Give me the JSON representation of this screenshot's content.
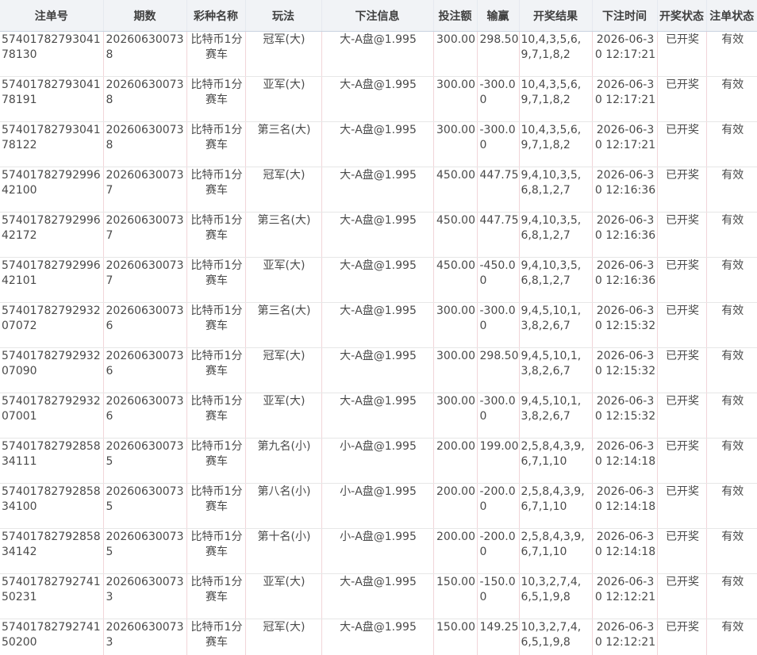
{
  "headers": [
    "注单号",
    "期数",
    "彩种名称",
    "玩法",
    "下注信息",
    "投注额",
    "输赢",
    "开奖结果",
    "下注时间",
    "开奖状态",
    "注单状态"
  ],
  "rows": [
    {
      "order_no": "5740178279304178130",
      "issue": "202606300738",
      "lottery": "比特币1分赛车",
      "play": "冠军(大)",
      "info": "大-A盘@1.995",
      "amount": "300.00",
      "win_loss": "298.50",
      "result": "10,4,3,5,6,9,7,1,8,2",
      "time": "2026-06-30 12:17:21",
      "draw_status": "已开奖",
      "order_status": "有效"
    },
    {
      "order_no": "5740178279304178191",
      "issue": "202606300738",
      "lottery": "比特币1分赛车",
      "play": "亚军(大)",
      "info": "大-A盘@1.995",
      "amount": "300.00",
      "win_loss": "-300.00",
      "result": "10,4,3,5,6,9,7,1,8,2",
      "time": "2026-06-30 12:17:21",
      "draw_status": "已开奖",
      "order_status": "有效"
    },
    {
      "order_no": "5740178279304178122",
      "issue": "202606300738",
      "lottery": "比特币1分赛车",
      "play": "第三名(大)",
      "info": "大-A盘@1.995",
      "amount": "300.00",
      "win_loss": "-300.00",
      "result": "10,4,3,5,6,9,7,1,8,2",
      "time": "2026-06-30 12:17:21",
      "draw_status": "已开奖",
      "order_status": "有效"
    },
    {
      "order_no": "5740178279299642100",
      "issue": "202606300737",
      "lottery": "比特币1分赛车",
      "play": "冠军(大)",
      "info": "大-A盘@1.995",
      "amount": "450.00",
      "win_loss": "447.75",
      "result": "9,4,10,3,5,6,8,1,2,7",
      "time": "2026-06-30 12:16:36",
      "draw_status": "已开奖",
      "order_status": "有效"
    },
    {
      "order_no": "5740178279299642172",
      "issue": "202606300737",
      "lottery": "比特币1分赛车",
      "play": "第三名(大)",
      "info": "大-A盘@1.995",
      "amount": "450.00",
      "win_loss": "447.75",
      "result": "9,4,10,3,5,6,8,1,2,7",
      "time": "2026-06-30 12:16:36",
      "draw_status": "已开奖",
      "order_status": "有效"
    },
    {
      "order_no": "5740178279299642101",
      "issue": "202606300737",
      "lottery": "比特币1分赛车",
      "play": "亚军(大)",
      "info": "大-A盘@1.995",
      "amount": "450.00",
      "win_loss": "-450.00",
      "result": "9,4,10,3,5,6,8,1,2,7",
      "time": "2026-06-30 12:16:36",
      "draw_status": "已开奖",
      "order_status": "有效"
    },
    {
      "order_no": "5740178279293207072",
      "issue": "202606300736",
      "lottery": "比特币1分赛车",
      "play": "第三名(大)",
      "info": "大-A盘@1.995",
      "amount": "300.00",
      "win_loss": "-300.00",
      "result": "9,4,5,10,1,3,8,2,6,7",
      "time": "2026-06-30 12:15:32",
      "draw_status": "已开奖",
      "order_status": "有效"
    },
    {
      "order_no": "5740178279293207090",
      "issue": "202606300736",
      "lottery": "比特币1分赛车",
      "play": "冠军(大)",
      "info": "大-A盘@1.995",
      "amount": "300.00",
      "win_loss": "298.50",
      "result": "9,4,5,10,1,3,8,2,6,7",
      "time": "2026-06-30 12:15:32",
      "draw_status": "已开奖",
      "order_status": "有效"
    },
    {
      "order_no": "5740178279293207001",
      "issue": "202606300736",
      "lottery": "比特币1分赛车",
      "play": "亚军(大)",
      "info": "大-A盘@1.995",
      "amount": "300.00",
      "win_loss": "-300.00",
      "result": "9,4,5,10,1,3,8,2,6,7",
      "time": "2026-06-30 12:15:32",
      "draw_status": "已开奖",
      "order_status": "有效"
    },
    {
      "order_no": "5740178279285834111",
      "issue": "202606300735",
      "lottery": "比特币1分赛车",
      "play": "第九名(小)",
      "info": "小-A盘@1.995",
      "amount": "200.00",
      "win_loss": "199.00",
      "result": "2,5,8,4,3,9,6,7,1,10",
      "time": "2026-06-30 12:14:18",
      "draw_status": "已开奖",
      "order_status": "有效"
    },
    {
      "order_no": "5740178279285834100",
      "issue": "202606300735",
      "lottery": "比特币1分赛车",
      "play": "第八名(小)",
      "info": "小-A盘@1.995",
      "amount": "200.00",
      "win_loss": "-200.00",
      "result": "2,5,8,4,3,9,6,7,1,10",
      "time": "2026-06-30 12:14:18",
      "draw_status": "已开奖",
      "order_status": "有效"
    },
    {
      "order_no": "5740178279285834142",
      "issue": "202606300735",
      "lottery": "比特币1分赛车",
      "play": "第十名(小)",
      "info": "小-A盘@1.995",
      "amount": "200.00",
      "win_loss": "-200.00",
      "result": "2,5,8,4,3,9,6,7,1,10",
      "time": "2026-06-30 12:14:18",
      "draw_status": "已开奖",
      "order_status": "有效"
    },
    {
      "order_no": "5740178279274150231",
      "issue": "202606300733",
      "lottery": "比特币1分赛车",
      "play": "亚军(大)",
      "info": "大-A盘@1.995",
      "amount": "150.00",
      "win_loss": "-150.00",
      "result": "10,3,2,7,4,6,5,1,9,8",
      "time": "2026-06-30 12:12:21",
      "draw_status": "已开奖",
      "order_status": "有效"
    },
    {
      "order_no": "5740178279274150200",
      "issue": "202606300733",
      "lottery": "比特币1分赛车",
      "play": "冠军(大)",
      "info": "大-A盘@1.995",
      "amount": "150.00",
      "win_loss": "149.25",
      "result": "10,3,2,7,4,6,5,1,9,8",
      "time": "2026-06-30 12:12:21",
      "draw_status": "已开奖",
      "order_status": "有效"
    }
  ]
}
